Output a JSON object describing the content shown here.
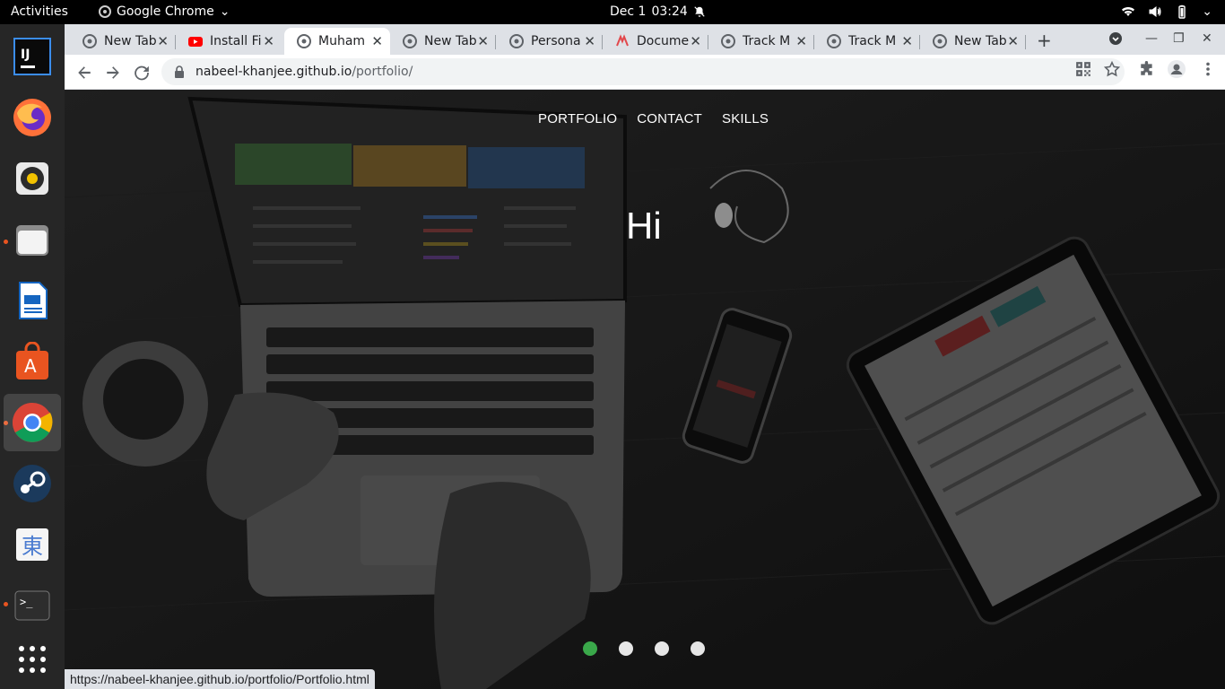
{
  "topbar": {
    "activities": "Activities",
    "app_name": "Google Chrome",
    "date": "Dec 1",
    "time": "03:24"
  },
  "dock": {
    "items": [
      "intellij-idea",
      "firefox",
      "rhythmbox",
      "files",
      "libreoffice-writer",
      "ubuntu-software",
      "google-chrome",
      "steam",
      "mozc-dictionary",
      "terminal",
      "show-applications"
    ]
  },
  "tabs": [
    {
      "title": "New Tab",
      "icon": "chrome"
    },
    {
      "title": "Install Fi",
      "icon": "youtube"
    },
    {
      "title": "Muham",
      "icon": "chrome",
      "active": true
    },
    {
      "title": "New Tab",
      "icon": "chrome"
    },
    {
      "title": "Persona",
      "icon": "chrome"
    },
    {
      "title": "Docume",
      "icon": "document"
    },
    {
      "title": "Track M",
      "icon": "chrome"
    },
    {
      "title": "Track M",
      "icon": "chrome"
    },
    {
      "title": "New Tab",
      "icon": "chrome"
    }
  ],
  "address": {
    "host": "nabeel-khanjee.github.io",
    "path": "/portfolio/"
  },
  "site": {
    "nav": [
      "PORTFOLIO",
      "CONTACT",
      "SKILLS"
    ],
    "hero_text": "Hi",
    "slide_count": 4,
    "active_slide": 1,
    "active_dot_color": "#3aa84a"
  },
  "status_url": "https://nabeel-khanjee.github.io/portfolio/Portfolio.html"
}
